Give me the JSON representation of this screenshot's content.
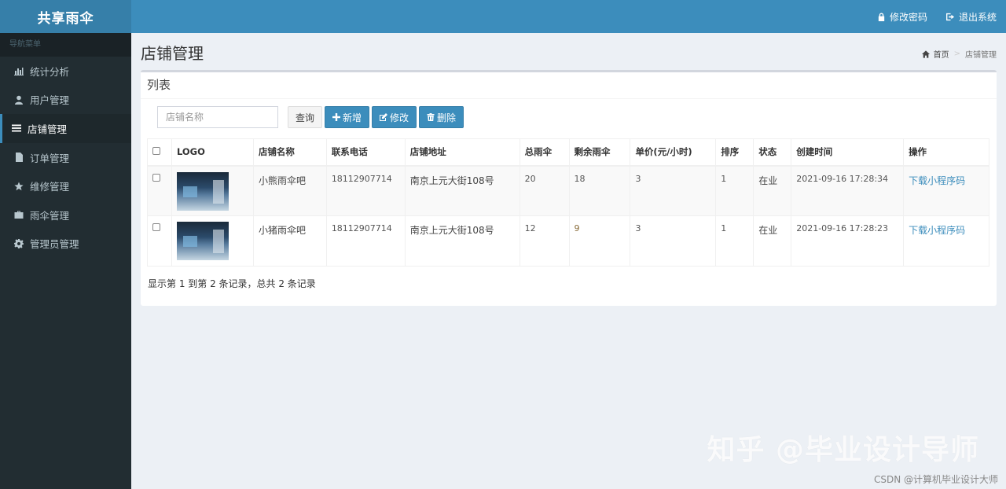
{
  "app": {
    "title": "共享雨伞"
  },
  "sidebar": {
    "header": "导航菜单",
    "items": [
      {
        "label": "统计分析",
        "icon": "bar-chart-icon",
        "active": false
      },
      {
        "label": "用户管理",
        "icon": "user-icon",
        "active": false
      },
      {
        "label": "店铺管理",
        "icon": "list-icon",
        "active": true
      },
      {
        "label": "订单管理",
        "icon": "file-icon",
        "active": false
      },
      {
        "label": "维修管理",
        "icon": "star-icon",
        "active": false
      },
      {
        "label": "雨伞管理",
        "icon": "briefcase-icon",
        "active": false
      },
      {
        "label": "管理员管理",
        "icon": "gear-icon",
        "active": false
      }
    ]
  },
  "topbar": {
    "change_password": "修改密码",
    "logout": "退出系统"
  },
  "page": {
    "title": "店铺管理",
    "breadcrumb": {
      "home": "首页",
      "current": "店铺管理"
    }
  },
  "box": {
    "title": "列表",
    "search": {
      "placeholder": "店铺名称",
      "value": ""
    },
    "buttons": {
      "query": "查询",
      "add": "新增",
      "edit": "修改",
      "delete": "删除"
    }
  },
  "table": {
    "headers": [
      "LOGO",
      "店铺名称",
      "联系电话",
      "店铺地址",
      "总雨伞",
      "剩余雨伞",
      "单价(元/小时)",
      "排序",
      "状态",
      "创建时间",
      "操作"
    ],
    "rows": [
      {
        "name": "小熊雨伞吧",
        "phone": "18112907714",
        "address": "南京上元大街108号",
        "total": "20",
        "remaining": "18",
        "price": "3",
        "sort": "1",
        "status": "在业",
        "created": "2021-09-16 17:28:34",
        "action": "下载小程序码"
      },
      {
        "name": "小猪雨伞吧",
        "phone": "18112907714",
        "address": "南京上元大街108号",
        "total": "12",
        "remaining": "9",
        "price": "3",
        "sort": "1",
        "status": "在业",
        "created": "2021-09-16 17:28:23",
        "action": "下载小程序码"
      }
    ]
  },
  "pagination": {
    "info": "显示第 1 到第 2 条记录，总共 2 条记录"
  },
  "watermark": "知乎 @毕业设计导师",
  "credit": "CSDN @计算机毕业设计大师",
  "colors": {
    "topbar": "#3c8dbc",
    "sidebar": "#222d32",
    "accent": "#3c8dbc"
  }
}
